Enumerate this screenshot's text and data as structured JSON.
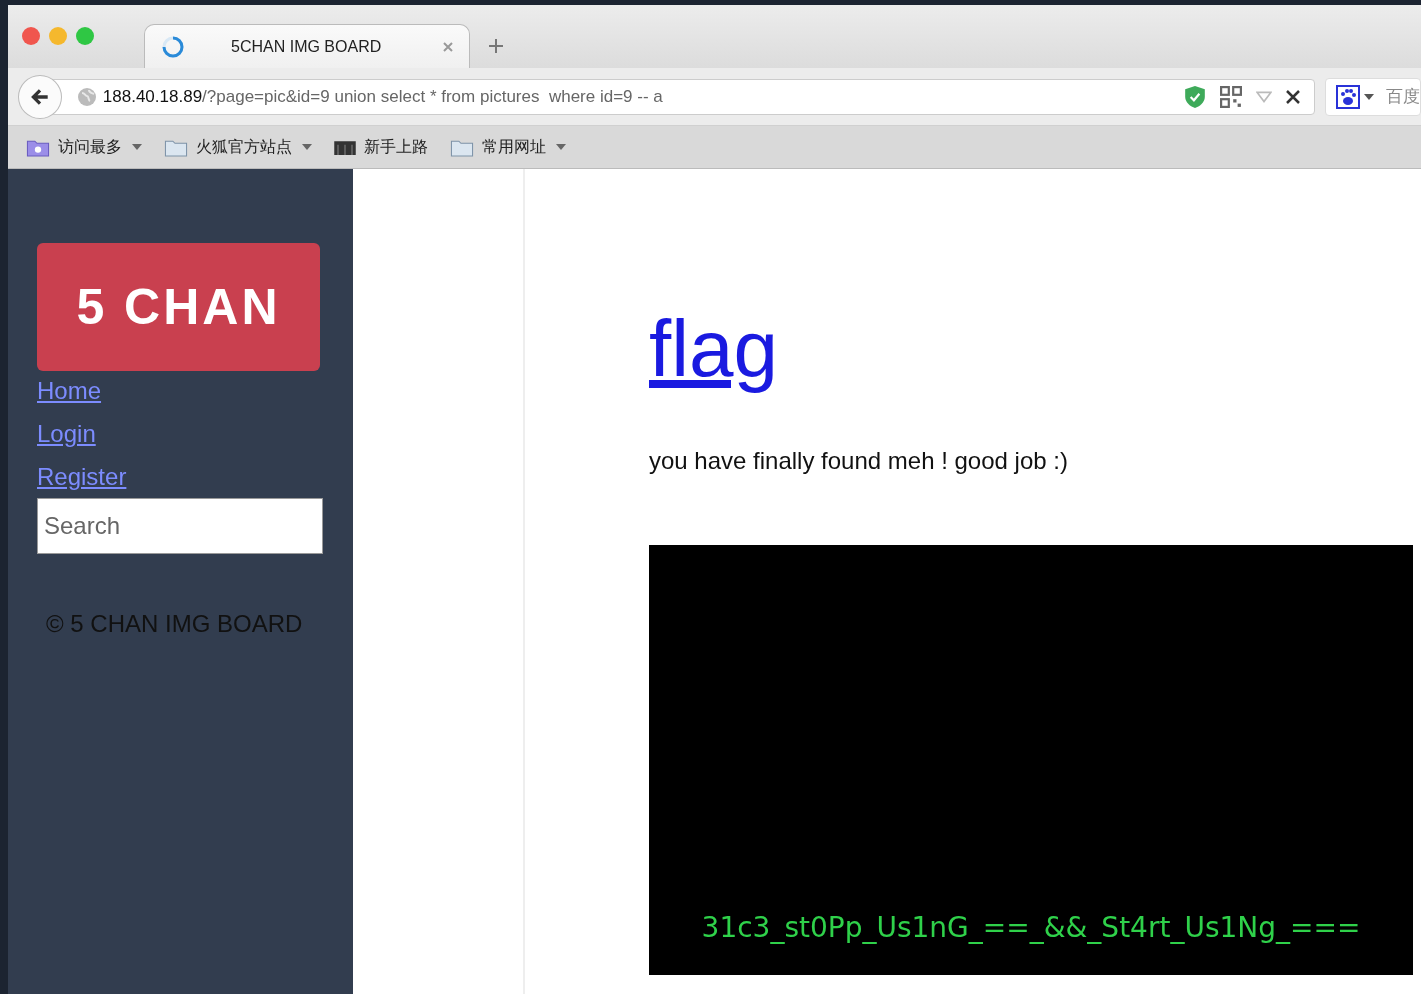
{
  "browser": {
    "tab": {
      "title": "5CHAN IMG BOARD"
    },
    "address": {
      "host": "188.40.18.89",
      "path": "/?page=pic&id=9 union select * from pictures  where id=9 -- a"
    },
    "search_engine": "百度",
    "bookmarks": [
      {
        "label": "访问最多",
        "kind": "smart",
        "menu": true
      },
      {
        "label": "火狐官方站点",
        "kind": "folder",
        "menu": true
      },
      {
        "label": "新手上路",
        "kind": "m",
        "menu": false
      },
      {
        "label": "常用网址",
        "kind": "folder",
        "menu": true
      }
    ]
  },
  "sidebar": {
    "logo": "5 CHAN",
    "links": [
      "Home",
      "Login",
      "Register"
    ],
    "search": {
      "placeholder": "Search"
    },
    "footer": "© 5 CHAN IMG BOARD"
  },
  "main": {
    "heading": "flag",
    "message": "you have finally found meh ! good job :)",
    "image_text": "31c3_st0Pp_Us1nG_==_&&_St4rt_Us1Ng_==="
  }
}
